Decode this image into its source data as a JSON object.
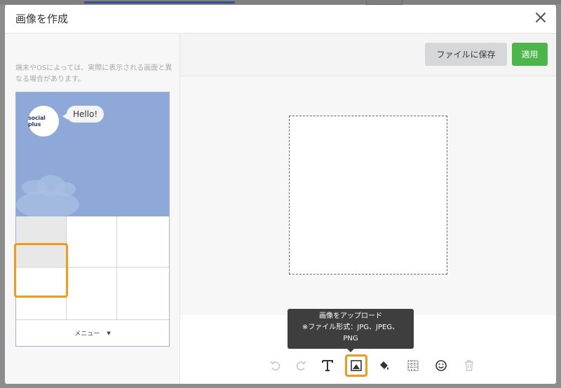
{
  "modal": {
    "title": "画像を作成"
  },
  "preview": {
    "notice": "端末やOSによっては、実際に表示される画面と異なる場合があります。",
    "logo_text": "social plus",
    "bubble_text": "Hello!",
    "menu_label": "メニュー"
  },
  "toolbar": {
    "save_label": "ファイルに保存",
    "apply_label": "適用"
  },
  "tooltip": {
    "line1": "画像をアップロード",
    "line2": "※ファイル形式：JPG、JPEG、",
    "line3": "PNG"
  },
  "tools": [
    {
      "name": "undo-icon",
      "enabled": false
    },
    {
      "name": "redo-icon",
      "enabled": false
    },
    {
      "name": "text-icon",
      "enabled": true
    },
    {
      "name": "image-upload-icon",
      "enabled": true,
      "active": true
    },
    {
      "name": "paint-bucket-icon",
      "enabled": true
    },
    {
      "name": "grid-pattern-icon",
      "enabled": true
    },
    {
      "name": "emoji-icon",
      "enabled": true
    },
    {
      "name": "trash-icon",
      "enabled": false
    }
  ],
  "colors": {
    "accent_orange": "#f19a1b",
    "apply_green": "#4cb64a",
    "preview_blue": "#8ea9d8"
  }
}
